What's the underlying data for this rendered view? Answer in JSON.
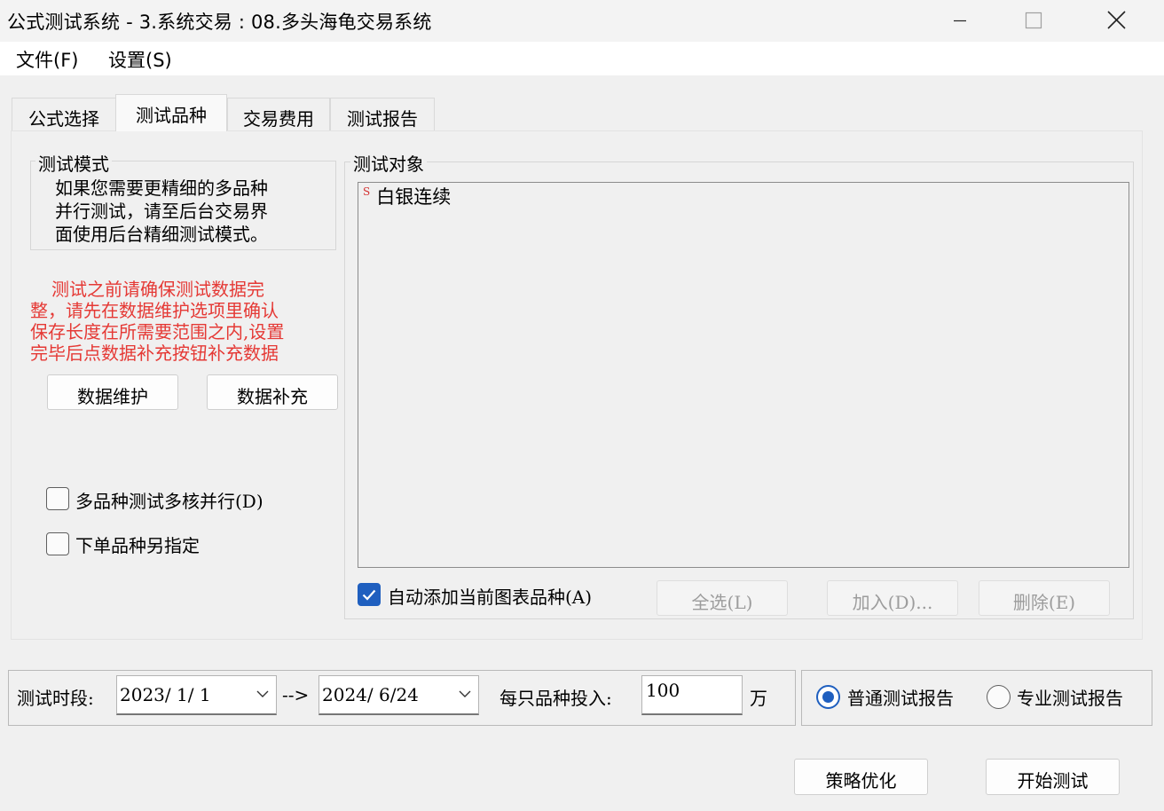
{
  "window": {
    "title": "公式测试系统 - 3.系统交易 : 08.多头海龟交易系统"
  },
  "menu": {
    "file": "文件(F)",
    "settings": "设置(S)"
  },
  "tabs": [
    {
      "label": "公式选择",
      "active": false
    },
    {
      "label": "测试品种",
      "active": true
    },
    {
      "label": "交易费用",
      "active": false
    },
    {
      "label": "测试报告",
      "active": false
    }
  ],
  "test_mode": {
    "title": "测试模式",
    "lines": [
      "如果您需要更精细的多品种",
      "并行测试，请至后台交易界",
      "面使用后台精细测试模式。"
    ]
  },
  "warning": {
    "lines": [
      "测试之前请确保测试数据完",
      "整，请先在数据维护选项里确认",
      "保存长度在所需要范围之内,设置",
      "完毕后点数据补充按钮补充数据"
    ],
    "color": "#e53935"
  },
  "buttons": {
    "data_maintain": "数据维护",
    "data_supplement": "数据补充",
    "select_all": "全选(L)",
    "add": "加入(D)...",
    "delete": "删除(E)",
    "optimize": "策略优化",
    "start_test": "开始测试"
  },
  "options": {
    "multicore": {
      "label": "多品种测试多核并行(D)",
      "checked": false
    },
    "order_symbol": {
      "label": "下单品种另指定",
      "checked": false
    },
    "auto_add": {
      "label": "自动添加当前图表品种(A)",
      "checked": true
    }
  },
  "test_target": {
    "title": "测试对象",
    "items": [
      {
        "mark": "S",
        "name": "白银连续"
      }
    ]
  },
  "period": {
    "label": "测试时段:",
    "start": "2023/ 1/ 1",
    "arrow": "-->",
    "end": "2024/ 6/24"
  },
  "investment": {
    "label": "每只品种投入:",
    "value": "100",
    "unit": "万"
  },
  "report_type": {
    "normal": {
      "label": "普通测试报告",
      "selected": true
    },
    "pro": {
      "label": "专业测试报告",
      "selected": false
    }
  },
  "colors": {
    "accent": "#1f5fbf",
    "warning": "#e53935"
  }
}
